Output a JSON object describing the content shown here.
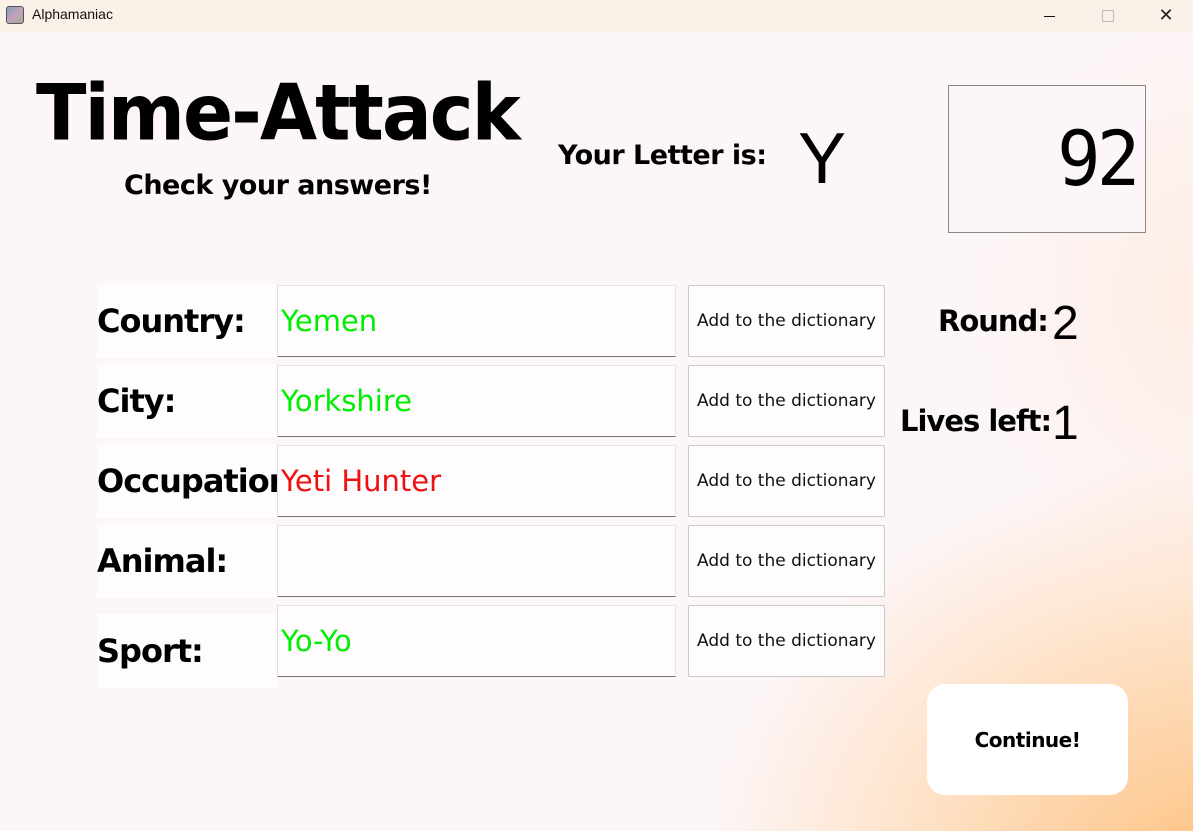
{
  "window": {
    "title": "Alphamaniac",
    "icon": "app-icon",
    "controls": {
      "minimize_icon": "minimize-icon",
      "maximize_icon": "maximize-icon",
      "close_icon": "close-icon",
      "close_glyph": "✕"
    }
  },
  "header": {
    "title": "Time-Attack",
    "subtitle": "Check your answers!",
    "letter_label": "Your Letter is:",
    "letter": "Y",
    "timer": "92"
  },
  "colors": {
    "correct": "#00ee00",
    "incorrect": "#ee1111"
  },
  "rows": [
    {
      "label": "Country:",
      "answer": "Yemen",
      "status": "correct",
      "button": "Add to the dictionary"
    },
    {
      "label": "City:",
      "answer": "Yorkshire",
      "status": "correct",
      "button": "Add to the dictionary"
    },
    {
      "label": "Occupation:",
      "answer": "Yeti Hunter",
      "status": "incorrect",
      "button": "Add to the dictionary"
    },
    {
      "label": "Animal:",
      "answer": "",
      "status": "empty",
      "button": "Add to the dictionary"
    },
    {
      "label": "Sport:",
      "answer": "Yo-Yo",
      "status": "correct",
      "button": "Add to the dictionary"
    }
  ],
  "stats": {
    "round_label": "Round:",
    "round": "2",
    "lives_label": "Lives left:",
    "lives": "1"
  },
  "continue_label": "Continue!"
}
